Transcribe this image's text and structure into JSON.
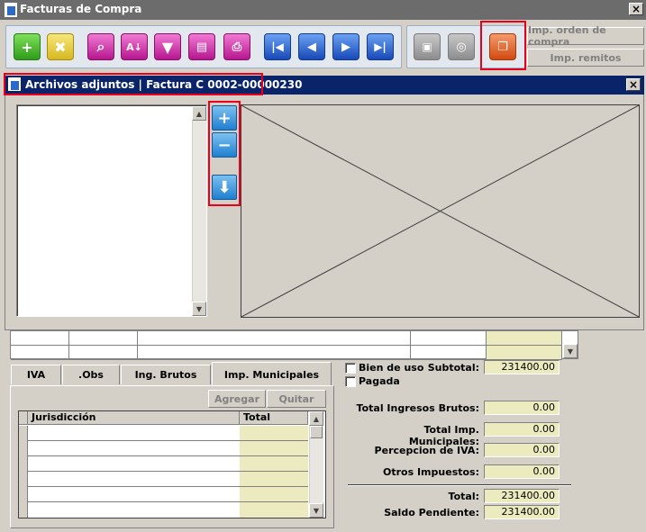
{
  "window": {
    "title": "Facturas de Compra",
    "close": "×"
  },
  "toolbar": {
    "icons": [
      "add-icon",
      "cancel-document-icon",
      "search-icon",
      "sort-az-icon",
      "filter-icon",
      "report-icon",
      "print-icon",
      "first-record-icon",
      "prev-record-icon",
      "next-record-icon",
      "last-record-icon",
      "disabled-icon",
      "disabled-icon",
      "attachments-icon"
    ],
    "print_purchase_order": "Imp. orden de compra",
    "print_delivery_notes": "Imp. remitos"
  },
  "dialog": {
    "title": "Archivos adjuntos | Factura C 0002-00000230",
    "close": "×",
    "buttons": [
      "add-attachment",
      "remove-attachment",
      "download-attachment"
    ]
  },
  "tabs": {
    "items": [
      {
        "label": "IVA"
      },
      {
        "label": ".Obs"
      },
      {
        "label": "Ing. Brutos"
      },
      {
        "label": "Imp. Municipales"
      }
    ],
    "active": "Imp. Municipales",
    "add_label": "Agregar",
    "remove_label": "Quitar",
    "columns": [
      "Jurisdicción",
      "Total"
    ]
  },
  "flags": {
    "bien_de_uso": "Bien de uso",
    "pagada": "Pagada"
  },
  "totals": {
    "subtotal_label": "Subtotal:",
    "subtotal": "231400.00",
    "ing_brutos_label": "Total Ingresos Brutos:",
    "ing_brutos": "0.00",
    "imp_municipales_label": "Total Imp. Municipales:",
    "imp_municipales": "0.00",
    "percepcion_iva_label": "Percepcion de IVA:",
    "percepcion_iva": "0.00",
    "otros_label": "Otros Impuestos:",
    "otros": "0.00",
    "total_label": "Total:",
    "total": "231400.00",
    "saldo_label": "Saldo Pendiente:",
    "saldo": "231400.00"
  },
  "colors": {
    "highlight": "#e8001c",
    "title_bar": "#0a246a",
    "value_bg": "#ecebbf"
  }
}
